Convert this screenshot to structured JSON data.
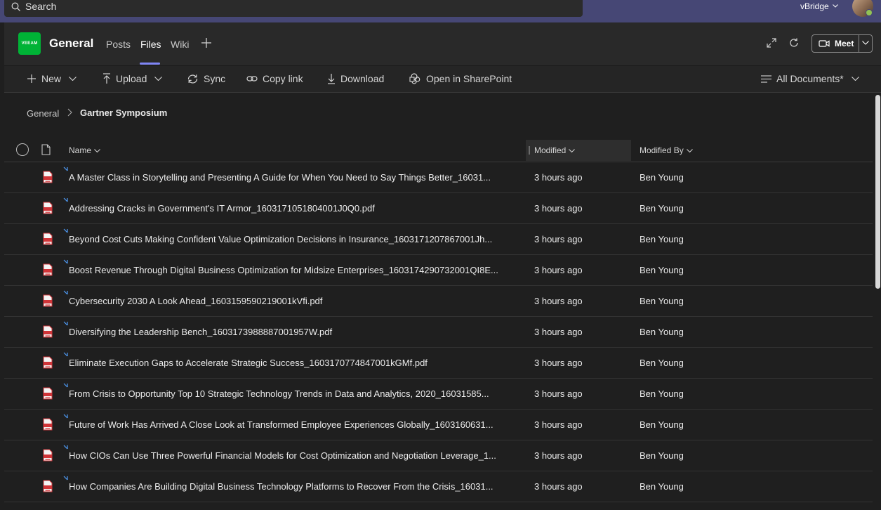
{
  "topbar": {
    "search_placeholder": "Search",
    "org_name": "vBridge"
  },
  "channel": {
    "team_logo_text": "VEEAM",
    "title": "General",
    "tabs": [
      {
        "label": "Posts"
      },
      {
        "label": "Files",
        "active": true
      },
      {
        "label": "Wiki"
      }
    ],
    "meet_label": "Meet"
  },
  "commands": {
    "new": "New",
    "upload": "Upload",
    "sync": "Sync",
    "copy_link": "Copy link",
    "download": "Download",
    "open_sharepoint": "Open in SharePoint",
    "view": "All Documents*"
  },
  "breadcrumb": {
    "root": "General",
    "current": "Gartner Symposium"
  },
  "columns": {
    "name": "Name",
    "modified": "Modified",
    "modified_by": "Modified By"
  },
  "files": [
    {
      "name": "A Master Class in Storytelling and Presenting A Guide for When You Need to Say Things Better_16031...",
      "modified": "3 hours ago",
      "modified_by": "Ben Young"
    },
    {
      "name": "Addressing Cracks in Government's IT Armor_1603171051804001J0Q0.pdf",
      "modified": "3 hours ago",
      "modified_by": "Ben Young"
    },
    {
      "name": "Beyond Cost Cuts Making Confident Value Optimization Decisions in Insurance_1603171207867001Jh...",
      "modified": "3 hours ago",
      "modified_by": "Ben Young"
    },
    {
      "name": "Boost Revenue Through Digital Business Optimization for Midsize Enterprises_1603174290732001QI8E...",
      "modified": "3 hours ago",
      "modified_by": "Ben Young"
    },
    {
      "name": "Cybersecurity 2030 A Look Ahead_1603159590219001kVfi.pdf",
      "modified": "3 hours ago",
      "modified_by": "Ben Young"
    },
    {
      "name": "Diversifying the Leadership Bench_1603173988887001957W.pdf",
      "modified": "3 hours ago",
      "modified_by": "Ben Young"
    },
    {
      "name": "Eliminate Execution Gaps to Accelerate Strategic Success_1603170774847001kGMf.pdf",
      "modified": "3 hours ago",
      "modified_by": "Ben Young"
    },
    {
      "name": "From Crisis to Opportunity Top 10 Strategic Technology Trends in Data and Analytics, 2020_16031585...",
      "modified": "3 hours ago",
      "modified_by": "Ben Young"
    },
    {
      "name": "Future of Work Has Arrived A Close Look at Transformed Employee Experiences Globally_1603160631...",
      "modified": "3 hours ago",
      "modified_by": "Ben Young"
    },
    {
      "name": "How CIOs Can Use Three Powerful Financial Models for Cost Optimization and Negotiation Leverage_1...",
      "modified": "3 hours ago",
      "modified_by": "Ben Young"
    },
    {
      "name": "How Companies Are Building Digital Business Technology Platforms to Recover From the Crisis_16031...",
      "modified": "3 hours ago",
      "modified_by": "Ben Young"
    }
  ],
  "colors": {
    "topbar": "#464775",
    "accent": "#7f85f5",
    "pdf_icon": "#d13438",
    "logo": "#00b336"
  }
}
